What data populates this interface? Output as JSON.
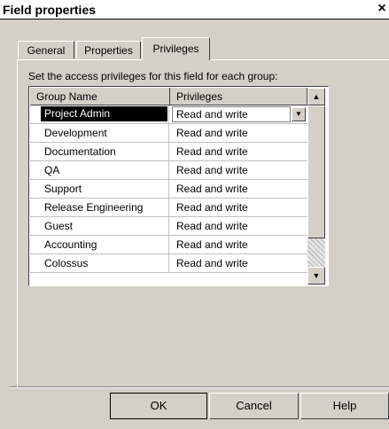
{
  "dialog": {
    "title": "Field properties",
    "close_glyph": "×"
  },
  "tabs": [
    {
      "label": "General",
      "active": false
    },
    {
      "label": "Properties",
      "active": false
    },
    {
      "label": "Privileges",
      "active": true
    }
  ],
  "description": "Set the access privileges for this field for each group:",
  "table": {
    "columns": [
      "Group Name",
      "Privileges"
    ],
    "rows": [
      {
        "group": "Project Admin",
        "privilege": "Read and write"
      },
      {
        "group": "Development",
        "privilege": "Read and write"
      },
      {
        "group": "Documentation",
        "privilege": "Read and write"
      },
      {
        "group": "QA",
        "privilege": "Read and write"
      },
      {
        "group": "Support",
        "privilege": "Read and write"
      },
      {
        "group": "Release Engineering",
        "privilege": "Read and write"
      },
      {
        "group": "Guest",
        "privilege": "Read and write"
      },
      {
        "group": "Accounting",
        "privilege": "Read and write"
      },
      {
        "group": "Colossus",
        "privilege": "Read and write"
      }
    ]
  },
  "buttons": {
    "ok": "OK",
    "cancel": "Cancel",
    "help": "Help"
  }
}
